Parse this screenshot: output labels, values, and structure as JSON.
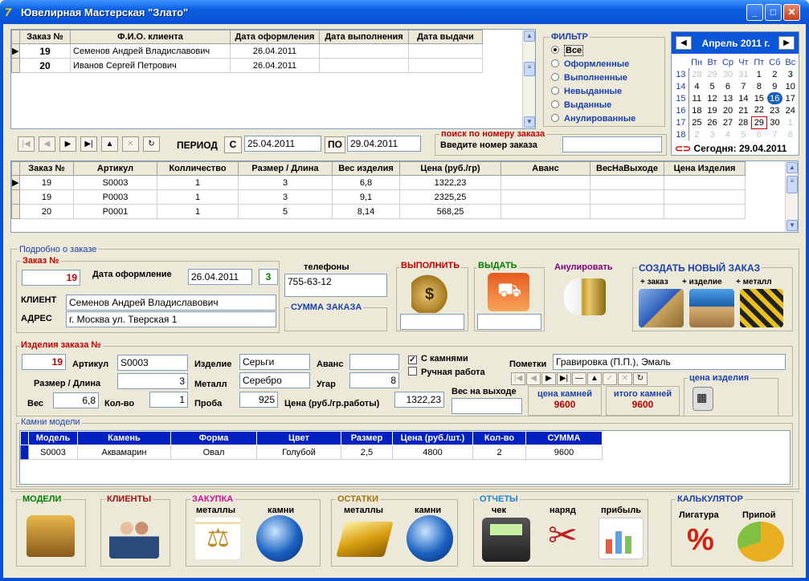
{
  "window": {
    "title": "Ювелирная Мастерская \"Злато\""
  },
  "orders": {
    "headers": [
      "Заказ №",
      "Ф.И.О. клиента",
      "Дата оформления",
      "Дата выполнения",
      "Дата выдачи"
    ],
    "rows": [
      {
        "num": "19",
        "client": "Семенов Андрей Владиславович",
        "date_created": "26.04.2011",
        "date_done": "",
        "date_issued": ""
      },
      {
        "num": "20",
        "client": "Иванов Сергей Петрович",
        "date_created": "26.04.2011",
        "date_done": "",
        "date_issued": ""
      }
    ]
  },
  "filter": {
    "title": "ФИЛЬТР",
    "options": [
      "Все",
      "Оформленные",
      "Выполненные",
      "Невыданные",
      "Выданные",
      "Анулированные"
    ],
    "selected": "Все"
  },
  "calendar": {
    "month": "Апрель 2011 г.",
    "weekdays": [
      "Пн",
      "Вт",
      "Ср",
      "Чт",
      "Пт",
      "Сб",
      "Вс"
    ],
    "weeks": [
      {
        "wk": "13",
        "days": [
          "28",
          "29",
          "30",
          "31",
          "1",
          "2",
          "3"
        ]
      },
      {
        "wk": "14",
        "days": [
          "4",
          "5",
          "6",
          "7",
          "8",
          "9",
          "10"
        ]
      },
      {
        "wk": "15",
        "days": [
          "11",
          "12",
          "13",
          "14",
          "15",
          "16",
          "17"
        ]
      },
      {
        "wk": "16",
        "days": [
          "18",
          "19",
          "20",
          "21",
          "22",
          "23",
          "24"
        ]
      },
      {
        "wk": "17",
        "days": [
          "25",
          "26",
          "27",
          "28",
          "29",
          "30",
          "1"
        ]
      },
      {
        "wk": "18",
        "days": [
          "2",
          "3",
          "4",
          "5",
          "6",
          "7",
          "8"
        ]
      }
    ],
    "today_label": "Сегодня: 29.04.2011"
  },
  "period": {
    "label": "ПЕРИОД",
    "from_btn": "С",
    "from": "25.04.2011",
    "to_btn": "ПО",
    "to": "29.04.2011"
  },
  "search": {
    "title": "поиск по номеру заказа",
    "label": "Введите номер заказа",
    "value": ""
  },
  "items": {
    "headers": [
      "Заказ №",
      "Артикул",
      "Колличество",
      "Размер / Длина",
      "Вес изделия",
      "Цена (руб./гр)",
      "Аванс",
      "ВесНаВыходе",
      "Цена Изделия"
    ],
    "rows": [
      [
        "19",
        "S0003",
        "1",
        "3",
        "6,8",
        "1322,23",
        "",
        "",
        ""
      ],
      [
        "19",
        "P0003",
        "1",
        "3",
        "9,1",
        "2325,25",
        "",
        "",
        ""
      ],
      [
        "20",
        "P0001",
        "1",
        "5",
        "8,14",
        "568,25",
        "",
        "",
        ""
      ]
    ]
  },
  "detail": {
    "title": "Подробно о заказе",
    "order_legend": "Заказ №",
    "order_num": "19",
    "date_label": "Дата оформление",
    "date": "26.04.2011",
    "count": "3",
    "client_label": "КЛИЕНТ",
    "client": "Семенов Андрей Владиславович",
    "address_label": "АДРЕС",
    "address": "г. Москва ул. Тверская 1",
    "phones_label": "телефоны",
    "phones": "755-63-12",
    "sum_label": "СУММА ЗАКАЗА",
    "execute": "ВЫПОЛНИТЬ",
    "issue": "ВЫДАТЬ",
    "cancel": "Анулировать",
    "create_title": "СОЗДАТЬ НОВЫЙ ЗАКАЗ",
    "create_sub": [
      "+ заказ",
      "+ изделие",
      "+ металл"
    ]
  },
  "product": {
    "legend": "Изделия заказа №",
    "num": "19",
    "article_label": "Артикул",
    "article": "S0003",
    "item_label": "Изделие",
    "item": "Серьги",
    "advance_label": "Аванс",
    "advance": "",
    "stones_label": "С камнями",
    "stones_checked": true,
    "handmade_label": "Ручная работа",
    "handmade_checked": false,
    "notes_label": "Пометки",
    "notes": "Гравировка (П.П.), Эмаль",
    "size_label": "Размер / Длина",
    "size": "3",
    "metal_label": "Металл",
    "metal": "Серебро",
    "loss_label": "Угар",
    "loss": "8",
    "weight_label": "Вес",
    "weight": "6,8",
    "qty_label": "Кол-во",
    "qty": "1",
    "probe_label": "Проба",
    "probe": "925",
    "price_label": "Цена (руб./гр.работы)",
    "price": "1322,23",
    "out_weight_label": "Вес на выходе",
    "out_weight": "",
    "stones_price_label": "цена камней",
    "stones_price": "9600",
    "stones_total_label": "итого камней",
    "stones_total": "9600",
    "item_price_label": "цена изделия"
  },
  "stones": {
    "legend": "Камни модели",
    "headers": [
      "Модель",
      "Камень",
      "Форма",
      "Цвет",
      "Размер",
      "Цена (руб./шт.)",
      "Кол-во",
      "СУММА"
    ],
    "rows": [
      [
        "S0003",
        "Аквамарин",
        "Овал",
        "Голубой",
        "2,5",
        "4800",
        "2",
        "9600"
      ]
    ]
  },
  "bottom": {
    "models": "МОДЕЛИ",
    "clients": "КЛИЕНТЫ",
    "purchase": "ЗАКУПКА",
    "purchase_metals": "металлы",
    "purchase_stones": "камни",
    "stock": "ОСТАТКИ",
    "stock_metals": "металлы",
    "stock_stones": "камни",
    "reports": "ОТЧЕТЫ",
    "rep_check": "чек",
    "rep_order": "наряд",
    "rep_profit": "прибыль",
    "calc": "КАЛЬКУЛЯТОР",
    "calc_alloy": "Лигатура",
    "calc_solder": "Припой"
  }
}
